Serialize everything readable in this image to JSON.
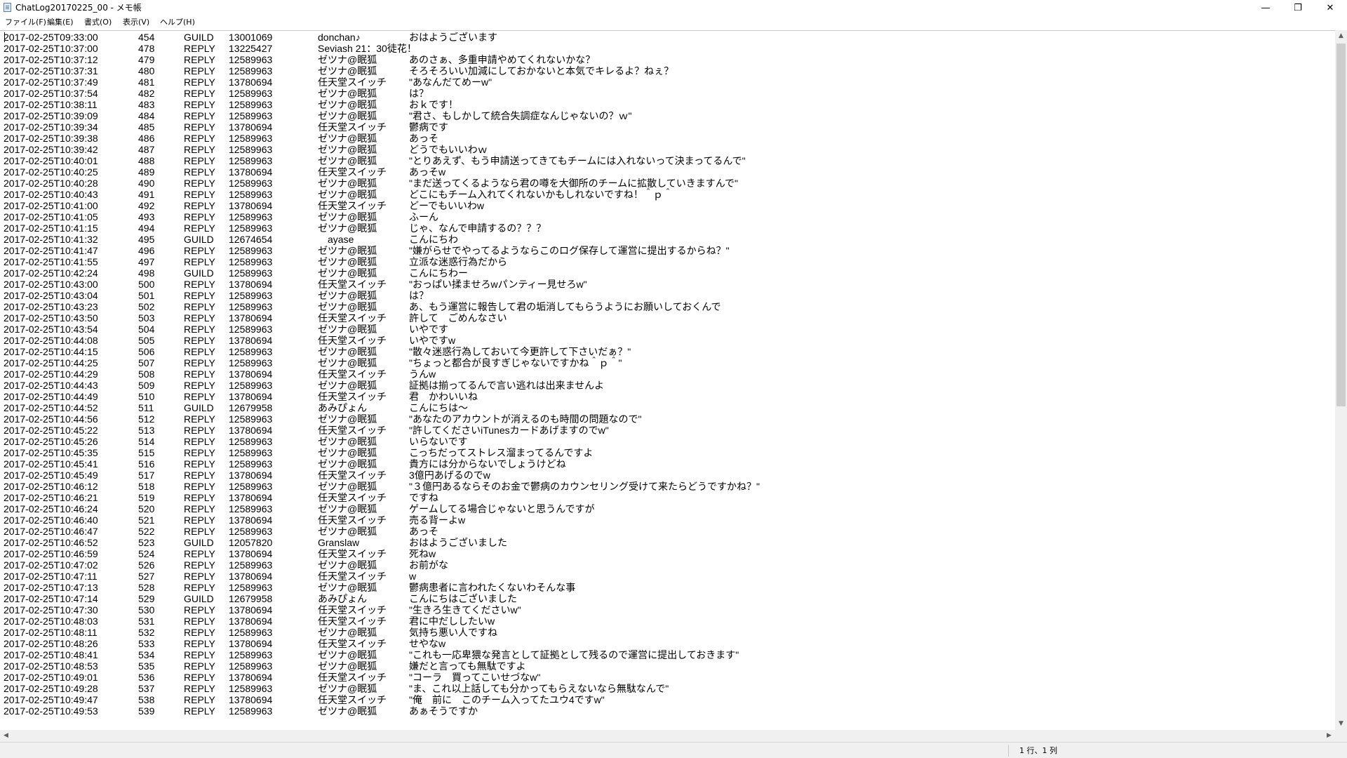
{
  "window": {
    "title": "ChatLog20170225_00 - メモ帳",
    "minimize": "—",
    "maximize": "❐",
    "close": "✕"
  },
  "menu": [
    "ファイル(F)",
    "編集(E)",
    "書式(O)",
    "表示(V)",
    "ヘルプ(H)"
  ],
  "status": {
    "position": "1 行、1 列"
  },
  "rows": [
    [
      "2017-02-25T09:33:00",
      "454",
      "GUILD",
      "13001069",
      "donchan♪",
      "おはようございます"
    ],
    [
      "2017-02-25T10:37:00",
      "478",
      "REPLY",
      "13225427",
      "Seviash 21：30徒花！",
      ""
    ],
    [
      "2017-02-25T10:37:12",
      "479",
      "REPLY",
      "12589963",
      "ゼツナ@眠狐",
      "あのさぁ、多重申請やめてくれないかな？"
    ],
    [
      "2017-02-25T10:37:31",
      "480",
      "REPLY",
      "12589963",
      "ゼツナ@眠狐",
      "そろそろいい加減にしておかないと本気でキレるよ？ねぇ？"
    ],
    [
      "2017-02-25T10:37:49",
      "481",
      "REPLY",
      "13780694",
      "任天堂スイッチ",
      "\"あなんだてめーw\""
    ],
    [
      "2017-02-25T10:37:54",
      "482",
      "REPLY",
      "12589963",
      "ゼツナ@眠狐",
      "は？"
    ],
    [
      "2017-02-25T10:38:11",
      "483",
      "REPLY",
      "12589963",
      "ゼツナ@眠狐",
      "おｋです！"
    ],
    [
      "2017-02-25T10:39:09",
      "484",
      "REPLY",
      "12589963",
      "ゼツナ@眠狐",
      "\"君さ、もしかして統合失調症なんじゃないの？ｗ\""
    ],
    [
      "2017-02-25T10:39:34",
      "485",
      "REPLY",
      "13780694",
      "任天堂スイッチ",
      "鬱病です"
    ],
    [
      "2017-02-25T10:39:38",
      "486",
      "REPLY",
      "12589963",
      "ゼツナ@眠狐",
      "あっそ"
    ],
    [
      "2017-02-25T10:39:42",
      "487",
      "REPLY",
      "12589963",
      "ゼツナ@眠狐",
      "どうでもいいわｗ"
    ],
    [
      "2017-02-25T10:40:01",
      "488",
      "REPLY",
      "12589963",
      "ゼツナ@眠狐",
      "\"とりあえず、もう申請送ってきてもチームには入れないって決まってるんで\""
    ],
    [
      "2017-02-25T10:40:25",
      "489",
      "REPLY",
      "13780694",
      "任天堂スイッチ",
      "あっそw"
    ],
    [
      "2017-02-25T10:40:28",
      "490",
      "REPLY",
      "12589963",
      "ゼツナ@眠狐",
      "\"まだ送ってくるようなら君の噂を大御所のチームに拡散していきますんで\""
    ],
    [
      "2017-02-25T10:40:43",
      "491",
      "REPLY",
      "12589963",
      "ゼツナ@眠狐",
      "どこにもチーム入れてくれないかもしれないですね！＾ｐ＾"
    ],
    [
      "2017-02-25T10:41:00",
      "492",
      "REPLY",
      "13780694",
      "任天堂スイッチ",
      "どーでもいいわw"
    ],
    [
      "2017-02-25T10:41:05",
      "493",
      "REPLY",
      "12589963",
      "ゼツナ@眠狐",
      "ふーん"
    ],
    [
      "2017-02-25T10:41:15",
      "494",
      "REPLY",
      "12589963",
      "ゼツナ@眠狐",
      "じゃ、なんで申請するの？？？"
    ],
    [
      "2017-02-25T10:41:32",
      "495",
      "GUILD",
      "12674654",
      "　ayase",
      "こんにちわ"
    ],
    [
      "2017-02-25T10:41:47",
      "496",
      "REPLY",
      "12589963",
      "ゼツナ@眠狐",
      "\"嫌がらせでやってるようならこのログ保存して運営に提出するからね？\""
    ],
    [
      "2017-02-25T10:41:55",
      "497",
      "REPLY",
      "12589963",
      "ゼツナ@眠狐",
      "立派な迷惑行為だから"
    ],
    [
      "2017-02-25T10:42:24",
      "498",
      "GUILD",
      "12589963",
      "ゼツナ@眠狐",
      "こんにちわー"
    ],
    [
      "2017-02-25T10:43:00",
      "500",
      "REPLY",
      "13780694",
      "任天堂スイッチ",
      "\"おっぱい揉ませろwパンティー見せろw\""
    ],
    [
      "2017-02-25T10:43:04",
      "501",
      "REPLY",
      "12589963",
      "ゼツナ@眠狐",
      "は？"
    ],
    [
      "2017-02-25T10:43:23",
      "502",
      "REPLY",
      "12589963",
      "ゼツナ@眠狐",
      "あ、もう運営に報告して君の垢消してもらうようにお願いしておくんで"
    ],
    [
      "2017-02-25T10:43:50",
      "503",
      "REPLY",
      "13780694",
      "任天堂スイッチ",
      "許して　ごめんなさい"
    ],
    [
      "2017-02-25T10:43:54",
      "504",
      "REPLY",
      "12589963",
      "ゼツナ@眠狐",
      "いやです"
    ],
    [
      "2017-02-25T10:44:08",
      "505",
      "REPLY",
      "13780694",
      "任天堂スイッチ",
      "いやですw"
    ],
    [
      "2017-02-25T10:44:15",
      "506",
      "REPLY",
      "12589963",
      "ゼツナ@眠狐",
      "\"散々迷惑行為しておいて今更許して下さいだぁ？\""
    ],
    [
      "2017-02-25T10:44:25",
      "507",
      "REPLY",
      "12589963",
      "ゼツナ@眠狐",
      "\"ちょっと都合が良すぎじゃないですかね＾ｐ＾\""
    ],
    [
      "2017-02-25T10:44:29",
      "508",
      "REPLY",
      "13780694",
      "任天堂スイッチ",
      "うんw"
    ],
    [
      "2017-02-25T10:44:43",
      "509",
      "REPLY",
      "12589963",
      "ゼツナ@眠狐",
      "証拠は揃ってるんで言い逃れは出来ませんよ"
    ],
    [
      "2017-02-25T10:44:49",
      "510",
      "REPLY",
      "13780694",
      "任天堂スイッチ",
      "君　かわいいね"
    ],
    [
      "2017-02-25T10:44:52",
      "511",
      "GUILD",
      "12679958",
      "あみぴょん",
      "こんにちは～"
    ],
    [
      "2017-02-25T10:44:56",
      "512",
      "REPLY",
      "12589963",
      "ゼツナ@眠狐",
      "\"あなたのアカウントが消えるのも時間の問題なので\""
    ],
    [
      "2017-02-25T10:45:22",
      "513",
      "REPLY",
      "13780694",
      "任天堂スイッチ",
      "\"許してくださいiTunesカードあげますのでw\""
    ],
    [
      "2017-02-25T10:45:26",
      "514",
      "REPLY",
      "12589963",
      "ゼツナ@眠狐",
      "いらないです"
    ],
    [
      "2017-02-25T10:45:35",
      "515",
      "REPLY",
      "12589963",
      "ゼツナ@眠狐",
      "こっちだってストレス溜まってるんですよ"
    ],
    [
      "2017-02-25T10:45:41",
      "516",
      "REPLY",
      "12589963",
      "ゼツナ@眠狐",
      "貴方には分からないでしょうけどね"
    ],
    [
      "2017-02-25T10:45:49",
      "517",
      "REPLY",
      "13780694",
      "任天堂スイッチ",
      "3億円あげるのでw"
    ],
    [
      "2017-02-25T10:46:12",
      "518",
      "REPLY",
      "12589963",
      "ゼツナ@眠狐",
      "\"３億円あるならそのお金で鬱病のカウンセリング受けて来たらどうですかね？\""
    ],
    [
      "2017-02-25T10:46:21",
      "519",
      "REPLY",
      "13780694",
      "任天堂スイッチ",
      "ですね"
    ],
    [
      "2017-02-25T10:46:24",
      "520",
      "REPLY",
      "12589963",
      "ゼツナ@眠狐",
      "ゲームしてる場合じゃないと思うんですが"
    ],
    [
      "2017-02-25T10:46:40",
      "521",
      "REPLY",
      "13780694",
      "任天堂スイッチ",
      "売る背ーよw"
    ],
    [
      "2017-02-25T10:46:47",
      "522",
      "REPLY",
      "12589963",
      "ゼツナ@眠狐",
      "あっそ"
    ],
    [
      "2017-02-25T10:46:52",
      "523",
      "GUILD",
      "12057820",
      "Granslaw",
      "おはようございました"
    ],
    [
      "2017-02-25T10:46:59",
      "524",
      "REPLY",
      "13780694",
      "任天堂スイッチ",
      "死ねw"
    ],
    [
      "2017-02-25T10:47:02",
      "526",
      "REPLY",
      "12589963",
      "ゼツナ@眠狐",
      "お前がな"
    ],
    [
      "2017-02-25T10:47:11",
      "527",
      "REPLY",
      "13780694",
      "任天堂スイッチ",
      "w"
    ],
    [
      "2017-02-25T10:47:13",
      "528",
      "REPLY",
      "12589963",
      "ゼツナ@眠狐",
      "鬱病患者に言われたくないわそんな事"
    ],
    [
      "2017-02-25T10:47:14",
      "529",
      "GUILD",
      "12679958",
      "あみぴょん",
      "こんにちはございました"
    ],
    [
      "2017-02-25T10:47:30",
      "530",
      "REPLY",
      "13780694",
      "任天堂スイッチ",
      "\"生きろ生きてくださいw\""
    ],
    [
      "2017-02-25T10:48:03",
      "531",
      "REPLY",
      "13780694",
      "任天堂スイッチ",
      "君に中だししたいw"
    ],
    [
      "2017-02-25T10:48:11",
      "532",
      "REPLY",
      "12589963",
      "ゼツナ@眠狐",
      "気持ち悪い人ですね"
    ],
    [
      "2017-02-25T10:48:26",
      "533",
      "REPLY",
      "13780694",
      "任天堂スイッチ",
      "せやなw"
    ],
    [
      "2017-02-25T10:48:41",
      "534",
      "REPLY",
      "12589963",
      "ゼツナ@眠狐",
      "\"これも一応卑猥な発言として証拠として残るので運営に提出しておきます\""
    ],
    [
      "2017-02-25T10:48:53",
      "535",
      "REPLY",
      "12589963",
      "ゼツナ@眠狐",
      "嫌だと言っても無駄ですよ"
    ],
    [
      "2017-02-25T10:49:01",
      "536",
      "REPLY",
      "13780694",
      "任天堂スイッチ",
      "\"コーラ　買ってこいせづなw\""
    ],
    [
      "2017-02-25T10:49:28",
      "537",
      "REPLY",
      "12589963",
      "ゼツナ@眠狐",
      "\"ま、これ以上話しても分かってもらえないなら無駄なんで\""
    ],
    [
      "2017-02-25T10:49:47",
      "538",
      "REPLY",
      "13780694",
      "任天堂スイッチ",
      "\"俺　前に　このチーム入ってたユウ4ですw\""
    ],
    [
      "2017-02-25T10:49:53",
      "539",
      "REPLY",
      "12589963",
      "ゼツナ@眠狐",
      "あぁそうですか"
    ]
  ]
}
